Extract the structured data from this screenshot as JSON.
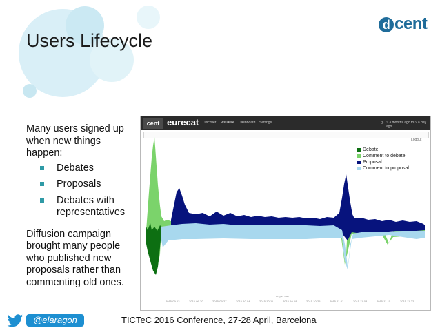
{
  "title": "Users Lifecycle",
  "logo": {
    "mark": "d",
    "text": "cent"
  },
  "body": {
    "intro": "Many users signed up when new things happen:",
    "bullets": [
      "Debates",
      "Proposals",
      "Debates with representatives"
    ],
    "conclusion": "Diffusion campaign brought many people who published new proposals rather than commenting old ones."
  },
  "footer": "TICTeC 2016 Conference, 27-28 April, Barcelona",
  "twitter": {
    "handle": "@elaragon"
  },
  "screenshot": {
    "brand": "cent",
    "app_name": "eurecat",
    "nav": [
      "Discover",
      "Visualize",
      "Dashboard",
      "Settings"
    ],
    "timefilter": "~ 3 months ago to ~ a day ago",
    "toolbar_right": "Logout",
    "x_axis_label": "on per day",
    "x_ticks": [
      "2015-09-13",
      "2015-09-20",
      "2015-09-27",
      "2015-10-04",
      "2015-10-11",
      "2015-10-18",
      "2015-10-25",
      "2015-11-01",
      "2015-11-08",
      "2015-11-15",
      "2015-11-22"
    ]
  },
  "chart_data": {
    "type": "area",
    "legend": [
      "Debate",
      "Comment to debate",
      "Proposal",
      "Comment to proposal"
    ],
    "colors": {
      "Debate": "#0d6f12",
      "Comment to debate": "#7bd36b",
      "Proposal": "#07137d",
      "Comment to proposal": "#a8d8ee"
    },
    "legend_position": "top-right"
  }
}
